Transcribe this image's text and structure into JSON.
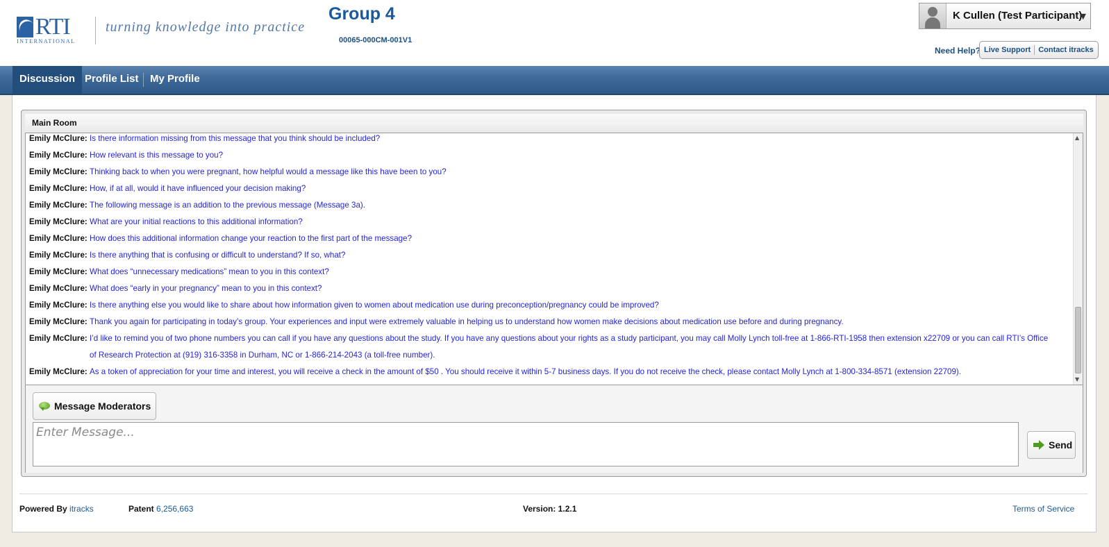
{
  "header": {
    "logo_letters": "RTI",
    "logo_sub": "INTERNATIONAL",
    "tagline": "turning knowledge into practice",
    "group_title": "Group 4",
    "group_code": "00065-000CM-001V1",
    "user_name": "K Cullen (Test Participant)",
    "need_help": "Need Help?",
    "live_support": "Live Support",
    "contact": "Contact itracks"
  },
  "nav": {
    "tabs": [
      {
        "label": "Discussion",
        "active": true
      },
      {
        "label": "Profile List",
        "active": false
      },
      {
        "label": "My Profile",
        "active": false
      }
    ]
  },
  "room": {
    "title": "Main Room",
    "messages": [
      {
        "sender": "Emily McClure:",
        "text": "Is there information missing from this message that you think should be included?"
      },
      {
        "sender": "Emily McClure:",
        "text": "How relevant is this message to you?"
      },
      {
        "sender": "Emily McClure:",
        "text": "Thinking back to when you were pregnant, how helpful would a message like this have been to you?"
      },
      {
        "sender": "Emily McClure:",
        "text": "How, if at all, would it have influenced your decision making?"
      },
      {
        "sender": "Emily McClure:",
        "text": "The following message is an addition to the previous message (Message 3a)."
      },
      {
        "sender": "Emily McClure:",
        "text": "What are your initial reactions to this additional information?"
      },
      {
        "sender": "Emily McClure:",
        "text": "How does this additional information change your reaction to the first part of the message?"
      },
      {
        "sender": "Emily McClure:",
        "text": "Is there anything that is confusing or difficult to understand? If so, what?"
      },
      {
        "sender": "Emily McClure:",
        "text": "What does “unnecessary medications” mean to you in this context?"
      },
      {
        "sender": "Emily McClure:",
        "text": "What does “early in your pregnancy” mean to you in this context?"
      },
      {
        "sender": "Emily McClure:",
        "text": "Is there anything else you would like to share about how information given to women about medication use during preconception/pregnancy could be improved?"
      },
      {
        "sender": "Emily McClure:",
        "text": "Thank you again for participating in today’s group. Your experiences and input were extremely valuable in helping us to understand how women make decisions about medication use before and during pregnancy."
      },
      {
        "sender": "Emily McClure:",
        "text": "I’d like to remind you of two phone numbers you can call if you have any questions about the study. If you have any questions about your rights as a study participant, you may call Molly Lynch toll-free at 1-866-RTI-1958 then extension x22709 or you can call RTI’s Office of Research Protection at (919) 316-3358 in Durham, NC or 1-866-214-2043 (a toll-free number)."
      },
      {
        "sender": "Emily McClure:",
        "text": "As a token of appreciation for your time and interest, you will receive a check in the amount of $50 . You should receive it within 5-7 business days. If you do not receive the check, please contact Molly Lynch at 1-800-334-8571 (extension 22709)."
      }
    ]
  },
  "compose": {
    "moderators_label": "Message Moderators",
    "input_placeholder": "Enter Message...",
    "input_value": "",
    "send_label": "Send"
  },
  "footer": {
    "powered_by": "Powered By",
    "powered_link": "itracks",
    "patent_label": "Patent",
    "patent_link": "6,256,663",
    "version": "Version: 1.2.1",
    "terms": "Terms of Service"
  },
  "colors": {
    "nav_bar": "#3e6898",
    "nav_active": "#234e7c",
    "message_text": "#2424d8",
    "link": "#1a5a9c"
  }
}
